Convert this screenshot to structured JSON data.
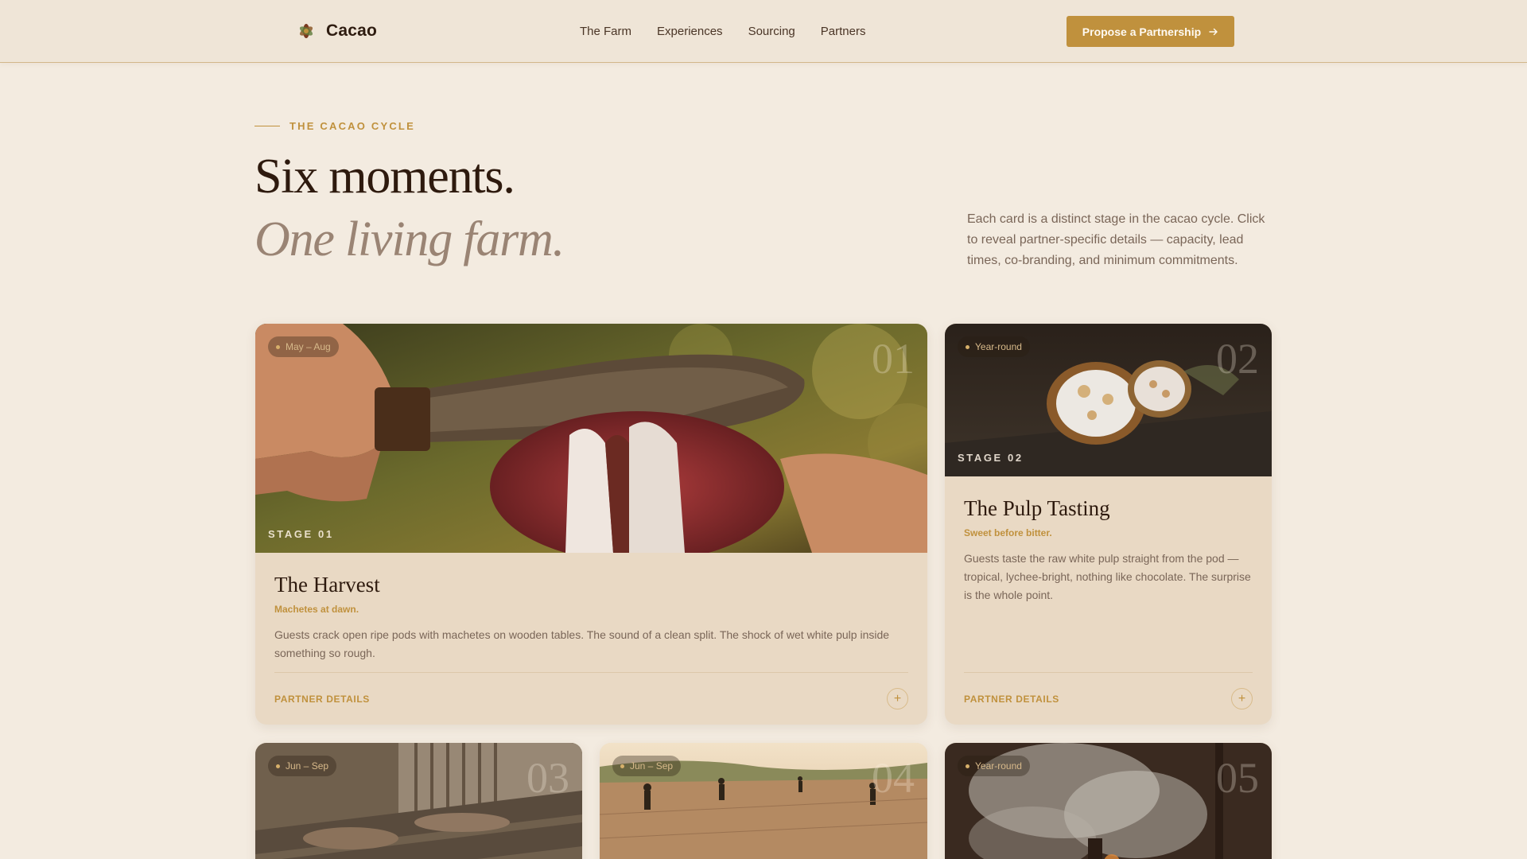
{
  "brand": {
    "name": "Cacao",
    "logo_icon": "cacao-pod-icon"
  },
  "nav": {
    "links": [
      "The Farm",
      "Experiences",
      "Sourcing",
      "Partners"
    ],
    "cta_label": "Propose a Partnership",
    "cta_icon": "arrow-right-icon"
  },
  "hero": {
    "eyebrow": "THE CACAO CYCLE",
    "headline": "Six moments.",
    "headline_italic": "One living farm.",
    "intro": "Each card is a distinct stage in the cacao cycle. Click to reveal partner-specific details — capacity, lead times, co-branding, and minimum commitments."
  },
  "cards": [
    {
      "season": "May – Aug",
      "number": "01",
      "stage": "STAGE 01",
      "title": "The Harvest",
      "subtitle": "Machetes at dawn.",
      "description": "Guests crack open ripe pods with machetes on wooden tables. The sound of a clean split. The shock of wet white pulp inside something so rough.",
      "partner_label": "PARTNER DETAILS",
      "toggle": "+"
    },
    {
      "season": "Year-round",
      "number": "02",
      "stage": "STAGE 02",
      "title": "The Pulp Tasting",
      "subtitle": "Sweet before bitter.",
      "description": "Guests taste the raw white pulp straight from the pod — tropical, lychee-bright, nothing like chocolate. The surprise is the whole point.",
      "partner_label": "PARTNER DETAILS",
      "toggle": "+"
    },
    {
      "season": "Jun – Sep",
      "number": "03"
    },
    {
      "season": "Jun – Sep",
      "number": "04"
    },
    {
      "season": "Year-round",
      "number": "05"
    }
  ],
  "colors": {
    "background": "#f3ebe0",
    "accent": "#c0913d",
    "card": "#e9d9c4",
    "heading": "#2e1a0e",
    "muted": "#9a8474"
  }
}
